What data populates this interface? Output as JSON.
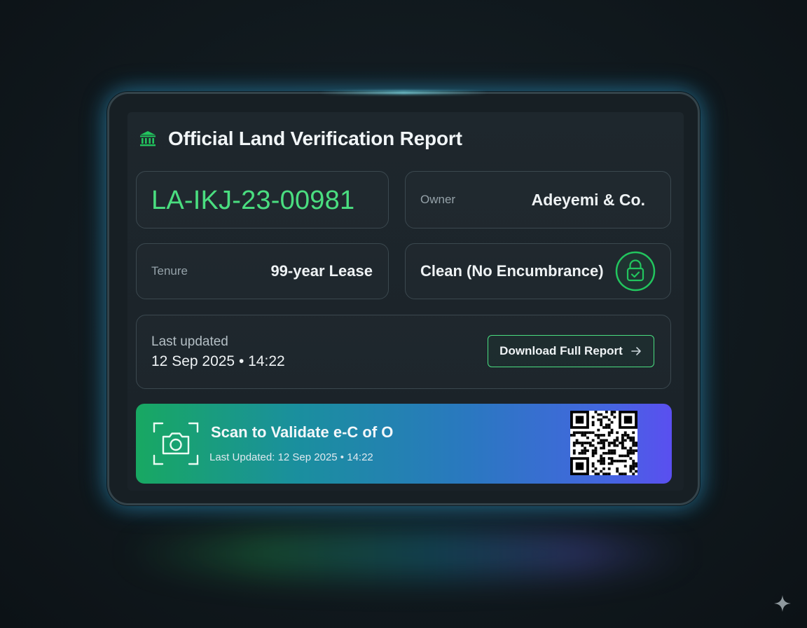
{
  "report": {
    "title": "Official Land Verification Report",
    "title_icon": "bank-building-icon",
    "parcel_id": "LA-IKJ-23-00981",
    "owner_label": "Owner",
    "owner_value": "Adeyemi & Co.",
    "tenure_label": "Tenure",
    "tenure_value": "99-year Lease",
    "status_text": "Clean (No Encumbrance)",
    "status_icon": "lock-check-icon",
    "last_updated_label": "Last updated",
    "last_updated_value": "12 Sep 2025 • 14:22",
    "download_button_label": "Download Full Report",
    "download_button_icon": "arrow-right-icon"
  },
  "validation_banner": {
    "title": "Scan to Validate e-C of O",
    "subtitle": "Last Updated: 12 Sep 2025 • 14:22",
    "scan_icon": "camera-scan-icon",
    "qr_icon": "qr-code-icon"
  },
  "colors": {
    "accent_green": "#4ade80",
    "banner_start": "#18a862",
    "banner_end": "#5a4ff0",
    "device_glow": "#7ee8f5"
  },
  "watermark_icon": "sparkle-icon"
}
